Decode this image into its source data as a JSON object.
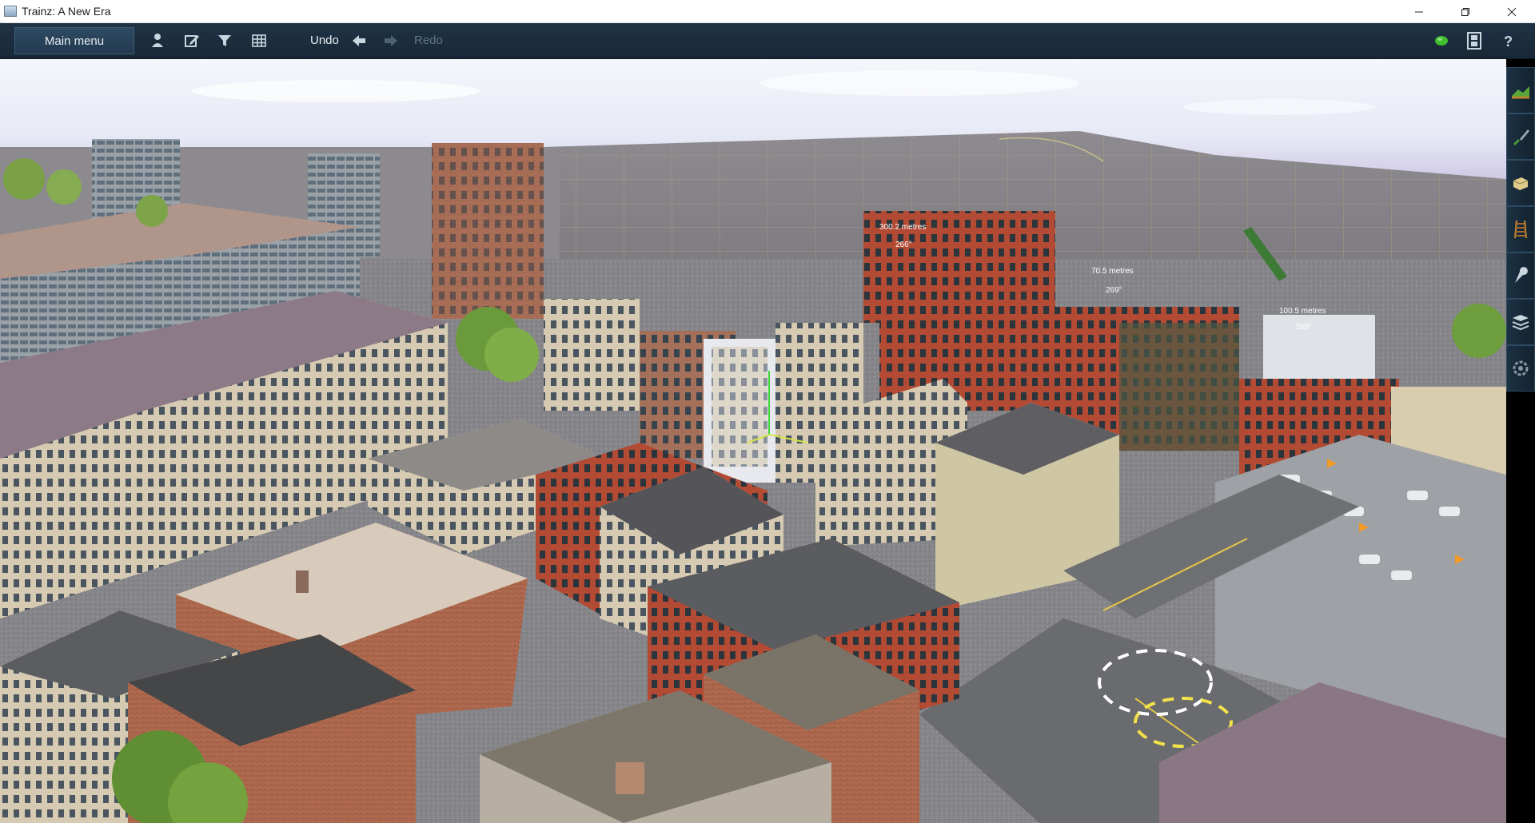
{
  "window": {
    "title": "Trainz: A New Era",
    "controls": [
      "minimize-icon",
      "restore-icon",
      "close-icon"
    ]
  },
  "toolbar": {
    "main_menu_label": "Main menu",
    "icons": [
      "driver-icon",
      "edit-icon",
      "filter-icon",
      "grid-icon"
    ],
    "undo_label": "Undo",
    "redo_label": "Redo",
    "right_icons": [
      "status-dot-icon",
      "film-icon",
      "help-icon"
    ],
    "status_color": "#3fbf2f"
  },
  "sidebar": {
    "tools": [
      "terrain-tool-icon",
      "paint-tool-icon",
      "objects-tool-icon",
      "track-tool-icon",
      "tools-wrench-icon",
      "layers-icon",
      "settings-gear-icon"
    ]
  },
  "scene": {
    "measurements": [
      {
        "distance": "300.2 metres",
        "angle": "266°"
      },
      {
        "distance": "70.5 metres",
        "angle": "269°"
      },
      {
        "distance": "100.5 metres",
        "angle": "265°"
      }
    ]
  }
}
